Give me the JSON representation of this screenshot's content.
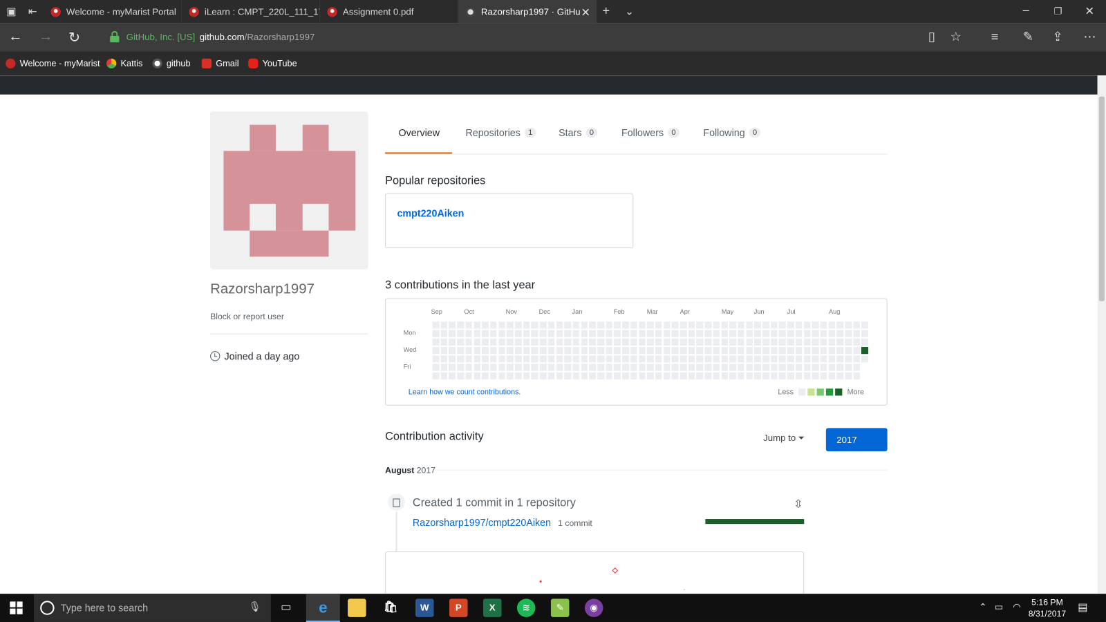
{
  "browser": {
    "tabs": [
      {
        "title": "Welcome - myMarist Portal",
        "active": false
      },
      {
        "title": "iLearn : CMPT_220L_111_17F",
        "active": false
      },
      {
        "title": "Assignment 0.pdf",
        "active": false
      },
      {
        "title": "Razorsharp1997 · GitHu",
        "active": true
      }
    ],
    "url_org": "GitHub, Inc. [US]",
    "url_host": "github.com",
    "url_path": "/Razorsharp1997",
    "bookmarks": [
      "Welcome - myMarist",
      "Kattis",
      "github",
      "Gmail",
      "YouTube"
    ]
  },
  "profile": {
    "username": "Razorsharp1997",
    "block_link": "Block or report user",
    "joined": "Joined a day ago",
    "avatar_color": "#d69299"
  },
  "tabs": {
    "overview": "Overview",
    "repositories": "Repositories",
    "repositories_count": "1",
    "stars": "Stars",
    "stars_count": "0",
    "followers": "Followers",
    "followers_count": "0",
    "following": "Following",
    "following_count": "0"
  },
  "popular": {
    "title": "Popular repositories",
    "repo": "cmpt220Aiken"
  },
  "contributions": {
    "title": "3 contributions in the last year",
    "months": [
      "Sep",
      "Oct",
      "Nov",
      "Dec",
      "Jan",
      "Feb",
      "Mar",
      "Apr",
      "May",
      "Jun",
      "Jul",
      "Aug"
    ],
    "days": [
      "Mon",
      "Wed",
      "Fri"
    ],
    "learn": "Learn how we count contributions.",
    "legend_less": "Less",
    "legend_more": "More",
    "level_colors": [
      "#ebedf0",
      "#c6e48b",
      "#7bc96f",
      "#239a3b",
      "#196127"
    ],
    "active_cell": {
      "week": 52,
      "day": 3,
      "level": 4
    }
  },
  "activity": {
    "title": "Contribution activity",
    "jump": "Jump to",
    "year": "2017",
    "month": "August",
    "month_year": "2017",
    "summary": "Created 1 commit in 1 repository",
    "repo": "Razorsharp1997/cmpt220Aiken",
    "repo_commits": "1 commit"
  },
  "taskbar": {
    "search_placeholder": "Type here to search",
    "time": "5:16 PM",
    "date": "8/31/2017"
  }
}
